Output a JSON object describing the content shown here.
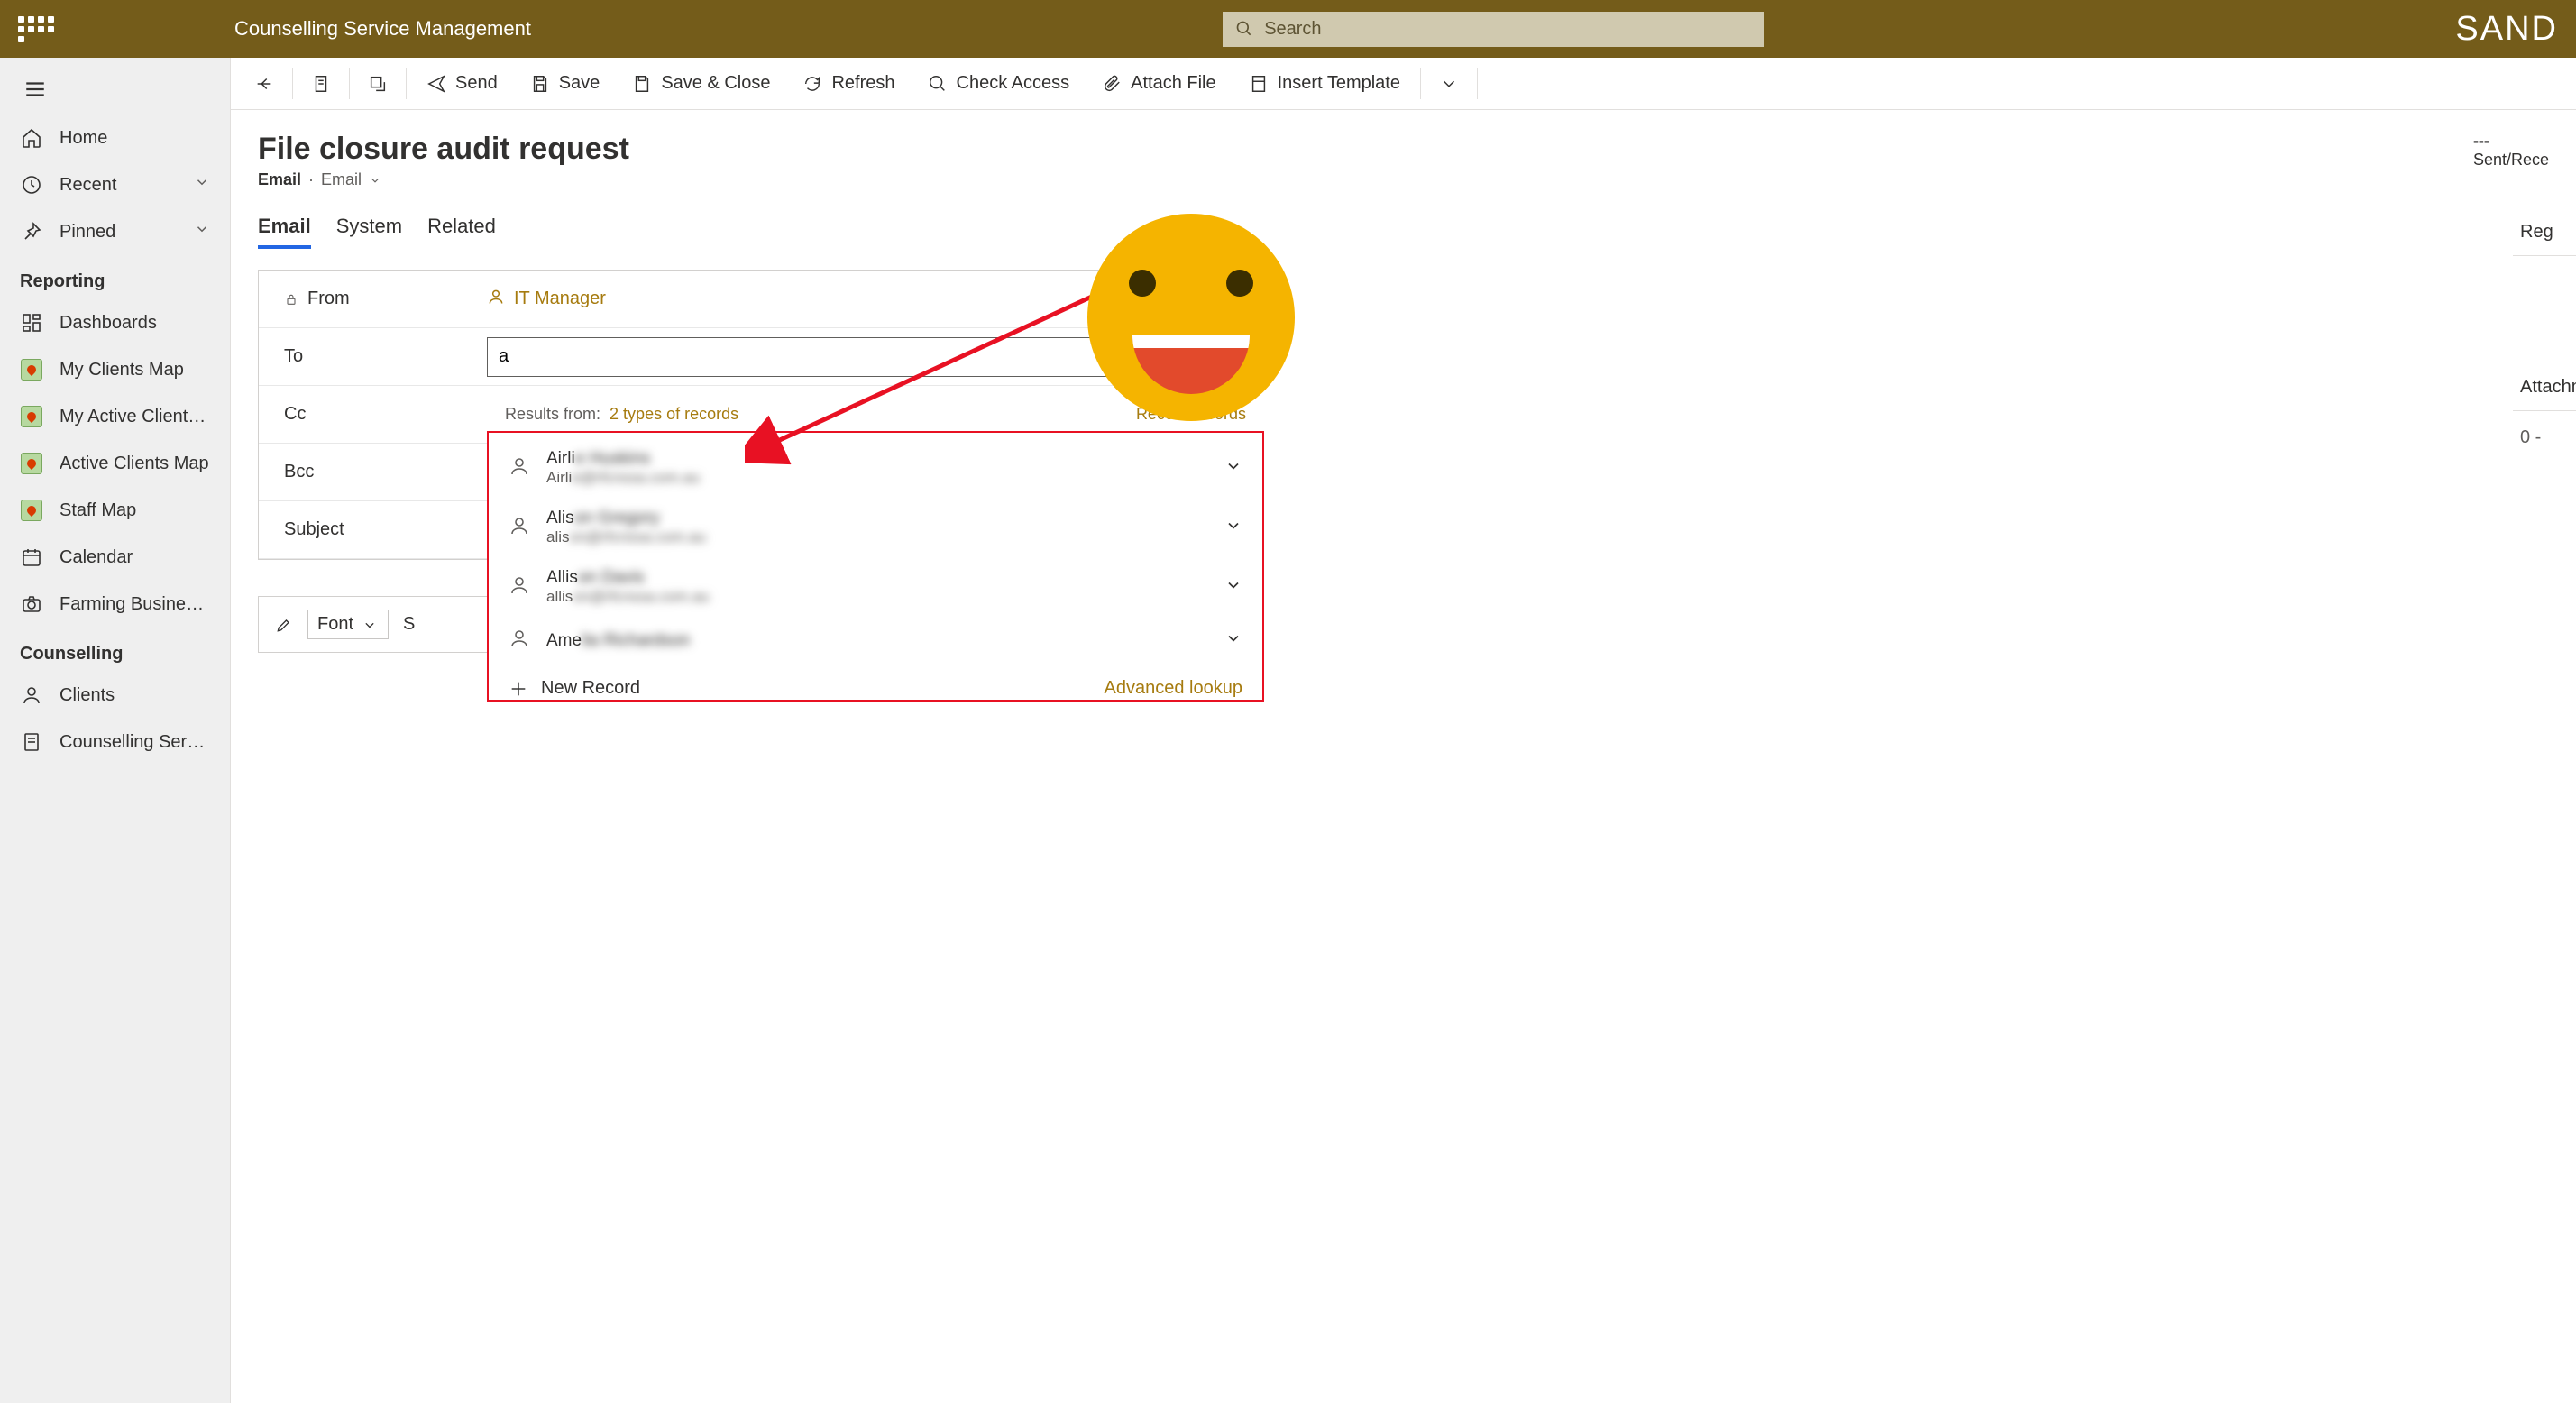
{
  "topbar": {
    "app_title": "Counselling Service Management",
    "search_placeholder": "Search",
    "env_label": "SAND"
  },
  "sidebar": {
    "items_top": [
      {
        "label": "Home",
        "icon": "home"
      },
      {
        "label": "Recent",
        "icon": "clock",
        "chevron": true
      },
      {
        "label": "Pinned",
        "icon": "pin",
        "chevron": true
      }
    ],
    "section_reporting": "Reporting",
    "items_reporting": [
      {
        "label": "Dashboards",
        "icon": "dashboard"
      },
      {
        "label": "My Clients Map",
        "icon": "map"
      },
      {
        "label": "My Active Clients ...",
        "icon": "map"
      },
      {
        "label": "Active Clients Map",
        "icon": "map"
      },
      {
        "label": "Staff Map",
        "icon": "map"
      },
      {
        "label": "Calendar",
        "icon": "calendar"
      },
      {
        "label": "Farming Business ...",
        "icon": "camera"
      }
    ],
    "section_counselling": "Counselling",
    "items_counselling": [
      {
        "label": "Clients",
        "icon": "person"
      },
      {
        "label": "Counselling Servi...",
        "icon": "form"
      }
    ]
  },
  "commandbar": {
    "send": "Send",
    "save": "Save",
    "save_close": "Save & Close",
    "refresh": "Refresh",
    "check_access": "Check Access",
    "attach_file": "Attach File",
    "insert_template": "Insert Template"
  },
  "header": {
    "title": "File closure audit request",
    "entity": "Email",
    "sub": "Email",
    "status_dash": "---",
    "status_label": "Sent/Rece"
  },
  "tabs": [
    "Email",
    "System",
    "Related"
  ],
  "form": {
    "from_label": "From",
    "from_value": "IT Manager",
    "to_label": "To",
    "to_value": "a",
    "cc_label": "Cc",
    "bcc_label": "Bcc",
    "subject_label": "Subject"
  },
  "lookup": {
    "results_from": "Results from:",
    "types": "2 types of records",
    "recent": "Recent records",
    "items": [
      {
        "name_prefix": "Airli",
        "name_blur": "e Huskins",
        "email_prefix": "Airli",
        "email_blur": "e@rfcnssa.com.au"
      },
      {
        "name_prefix": "Alis",
        "name_blur": "on Gregory",
        "email_prefix": "alis",
        "email_blur": "on@rfcnssa.com.au"
      },
      {
        "name_prefix": "Allis",
        "name_blur": "on Davis",
        "email_prefix": "allis",
        "email_blur": "on@rfcnssa.com.au"
      },
      {
        "name_prefix": "Ame",
        "name_blur": "lia Richardson",
        "email_prefix": "",
        "email_blur": ""
      }
    ],
    "new_record": "New Record",
    "advanced": "Advanced lookup"
  },
  "right": {
    "regarding": "Reg",
    "attachments": "Attachm",
    "pager": "0 -"
  },
  "editor": {
    "font_label": "Font",
    "size_prefix": "S"
  }
}
